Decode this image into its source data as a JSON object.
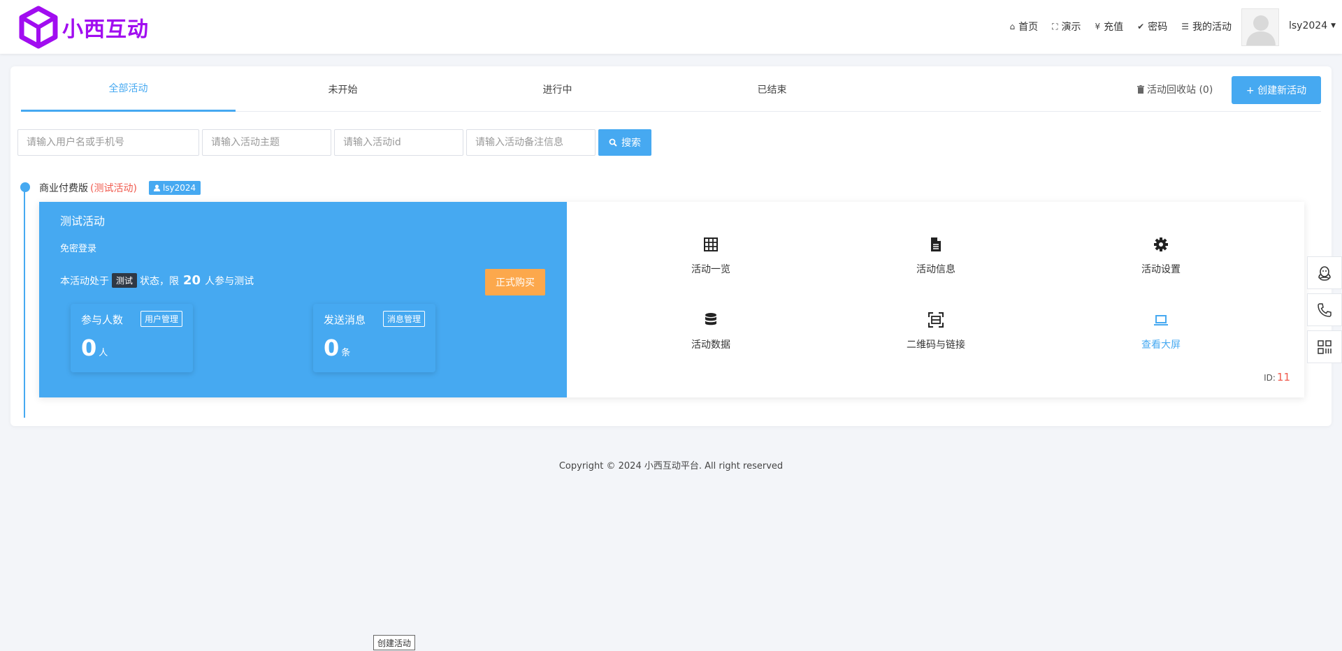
{
  "header": {
    "logo_text": "小西互动",
    "nav": [
      {
        "icon": "home-icon",
        "glyph": "⌂",
        "label": "首页"
      },
      {
        "icon": "expand-icon",
        "glyph": "⛶",
        "label": "演示"
      },
      {
        "icon": "yen-icon",
        "glyph": "¥",
        "label": "充值"
      },
      {
        "icon": "check-circle-icon",
        "glyph": "✔",
        "label": "密码"
      },
      {
        "icon": "list-icon",
        "glyph": "☰",
        "label": "我的活动"
      }
    ],
    "username": "lsy2024"
  },
  "tabs": [
    {
      "label": "全部活动",
      "active": true
    },
    {
      "label": "未开始",
      "active": false
    },
    {
      "label": "进行中",
      "active": false
    },
    {
      "label": "已结束",
      "active": false
    }
  ],
  "toolbar": {
    "recycle_label": "活动回收站 (0)",
    "create_label": "+ 创建新活动"
  },
  "search": {
    "user_placeholder": "请输入用户名或手机号",
    "topic_placeholder": "请输入活动主题",
    "id_placeholder": "请输入活动id",
    "note_placeholder": "请输入活动备注信息",
    "button_label": "搜索"
  },
  "timeline": {
    "edition": "商业付费版",
    "test_label": "(测试活动)",
    "user": "lsy2024"
  },
  "activity": {
    "title": "测试活动",
    "login_mode": "免密登录",
    "status_prefix": "本活动处于",
    "status_pill": "测试",
    "status_middle": "状态，限",
    "limit": "20",
    "status_suffix": "人参与测试",
    "buy_label": "正式购买",
    "stats": [
      {
        "label": "参与人数",
        "tag": "用户管理",
        "value": "0",
        "unit": "人"
      },
      {
        "label": "发送消息",
        "tag": "消息管理",
        "value": "0",
        "unit": "条"
      }
    ],
    "actions": [
      {
        "label": "活动一览",
        "icon": "grid-icon"
      },
      {
        "label": "活动信息",
        "icon": "document-icon"
      },
      {
        "label": "活动设置",
        "icon": "gear-icon"
      },
      {
        "label": "活动数据",
        "icon": "database-icon"
      },
      {
        "label": "二维码与链接",
        "icon": "scan-icon"
      },
      {
        "label": "查看大屏",
        "icon": "laptop-icon"
      }
    ],
    "id_label": "ID:",
    "id_value": "11"
  },
  "footer": {
    "copyright": "Copyright © 2024 小西互动平台. All right reserved"
  },
  "tooltip": {
    "text": "创建活动"
  },
  "colors": {
    "primary": "#46a9f1",
    "brand": "#a10df0",
    "warning": "#fca84c",
    "danger": "#f05b4f"
  }
}
